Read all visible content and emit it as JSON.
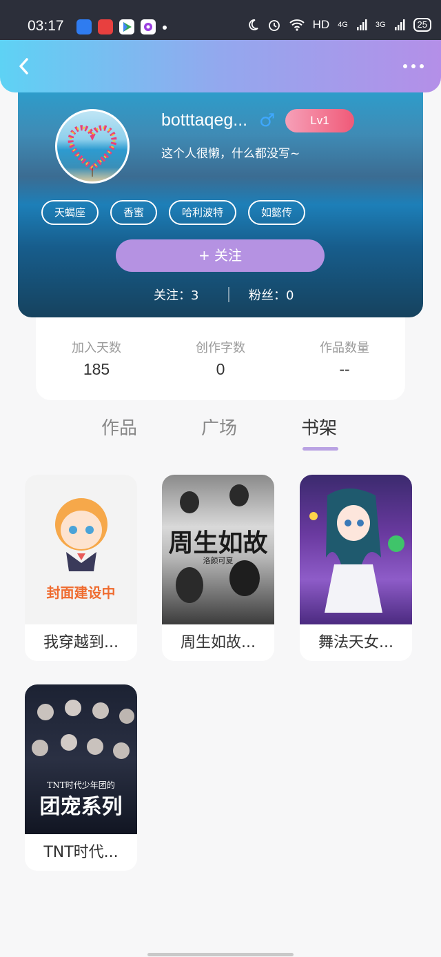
{
  "status_bar": {
    "time": "03:17",
    "network_label": "HD",
    "signal_1": "4G",
    "signal_2": "3G",
    "battery": "25",
    "icons": [
      "moon-icon",
      "alarm-icon",
      "wifi-icon"
    ]
  },
  "nav": {
    "back_icon": "chevron-left-icon",
    "more_icon": "more-dots-icon"
  },
  "profile": {
    "username": "botttaqeg...",
    "gender_symbol": "♂",
    "level": "Lv1",
    "bio": "这个人很懒，什么都没写~",
    "tags": [
      "天蝎座",
      "香蜜",
      "哈利波特",
      "如懿传"
    ],
    "follow_button": "+  关注",
    "following_label": "关注：3",
    "fans_label": "粉丝：0",
    "colors": {
      "gender": "#3fa8ff",
      "follow_button": "#b592e2",
      "level_badge": "#f05a78"
    }
  },
  "stats": [
    {
      "label": "加入天数",
      "value": "185"
    },
    {
      "label": "创作字数",
      "value": "0"
    },
    {
      "label": "作品数量",
      "value": "--"
    }
  ],
  "tabs": [
    {
      "label": "作品",
      "active": false
    },
    {
      "label": "广场",
      "active": false
    },
    {
      "label": "书架",
      "active": true
    }
  ],
  "books": [
    {
      "title": "我穿越到...",
      "cover_text": "封面建设中"
    },
    {
      "title": "周生如故...",
      "cover_text": "周生如故",
      "cover_subtext": "洛颜可夏"
    },
    {
      "title": "舞法天女...",
      "cover_text": ""
    },
    {
      "title": "TNT时代...",
      "cover_text": "团宠系列",
      "cover_subtext": "TNT时代少年团的"
    }
  ]
}
